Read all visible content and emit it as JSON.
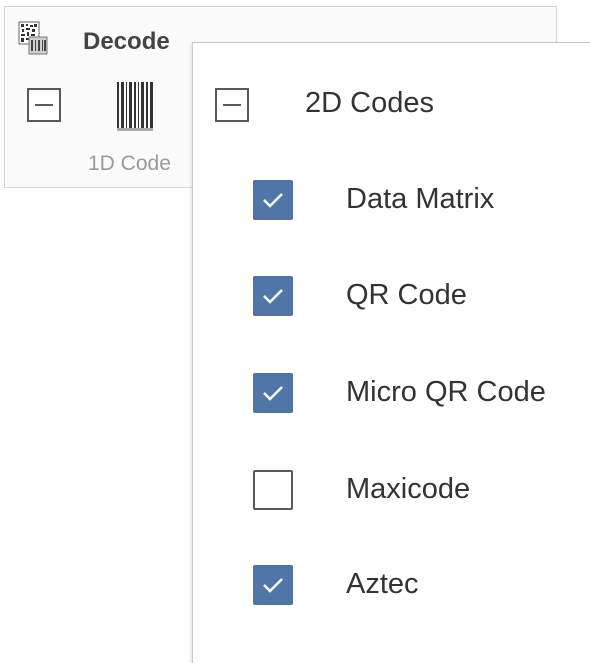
{
  "panel": {
    "title": "Decode",
    "icon": "datamatrix-icon",
    "one_d": {
      "label": "1D Code",
      "icon": "barcode-icon",
      "collapse_icon": "minus-box-icon"
    }
  },
  "dropdown": {
    "group": {
      "label": "2D Codes",
      "collapse_icon": "minus-box-icon"
    },
    "options": [
      {
        "label": "Data Matrix",
        "checked": true
      },
      {
        "label": "QR Code",
        "checked": true
      },
      {
        "label": "Micro QR Code",
        "checked": true
      },
      {
        "label": "Maxicode",
        "checked": false
      },
      {
        "label": "Aztec",
        "checked": true
      }
    ]
  },
  "colors": {
    "checkbox_checked": "#4f76a6",
    "text": "#333333",
    "muted_label": "#9a9a9a"
  }
}
